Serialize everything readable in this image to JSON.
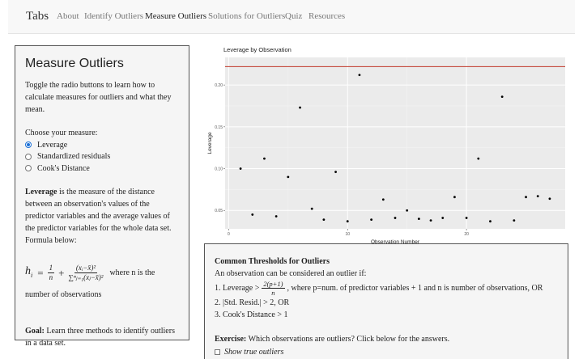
{
  "navbar": {
    "brand": "Tabs",
    "items": [
      {
        "label": "About",
        "active": false
      },
      {
        "label": "Identify Outliers",
        "active": false
      },
      {
        "label": "Measure Outliers",
        "active": true
      },
      {
        "label": "Solutions for Outliers",
        "active": false
      },
      {
        "label": "Quiz",
        "active": false
      },
      {
        "label": "Resources",
        "active": false
      }
    ]
  },
  "sidebar": {
    "title": "Measure Outliers",
    "intro": "Toggle the radio buttons to learn how to calculate measures for outliers and what they mean.",
    "choose_label": "Choose your measure:",
    "options": [
      {
        "label": "Leverage",
        "checked": true
      },
      {
        "label": "Standardized residuals",
        "checked": false
      },
      {
        "label": "Cook's Distance",
        "checked": false
      }
    ],
    "desc_bold": "Leverage",
    "desc_rest": " is the measure of the distance between an observation's values of the predictor variables and the average values of the predictor variables for the whole data set. Formula below:",
    "formula": {
      "lhs": "h",
      "lhs_sub": "i",
      "equals": "=",
      "t1_num": "1",
      "t1_den": "n",
      "plus": "+",
      "t2_num": "(xᵢ−x̄)²",
      "t2_den": "∑ⁿⱼ₌₁(xⱼ−x̄)²",
      "where_text": "where n is the",
      "cont_text": "number of observations"
    },
    "goal_bold": "Goal:",
    "goal_rest": " Learn three methods to identify outliers in a data set."
  },
  "thresholds": {
    "title": "Common Thresholds for Outliers",
    "intro": "An observation can be considered an outlier if:",
    "item1_prefix": "1. Leverage >",
    "item1_num": "2(p+1)",
    "item1_den": "n",
    "item1_suffix": ", where p=num. of predictor variables + 1 and n is number of observations, OR",
    "item2": "2. |Std. Resid.| > 2, OR",
    "item3": "3. Cook's Distance > 1",
    "exercise_bold": "Exercise:",
    "exercise_rest": " Which observations are outliers? Click below for the answers.",
    "checkbox_label": "Show true outliers"
  },
  "chart_data": {
    "type": "scatter",
    "title": "Leverage by Observation",
    "xlabel": "Observation Number",
    "ylabel": "Leverage",
    "xlim": [
      -0.3,
      28.3
    ],
    "ylim": [
      0.028,
      0.233
    ],
    "xticks": [
      0,
      10,
      20
    ],
    "yticks": [
      0.05,
      0.1,
      0.15,
      0.2
    ],
    "ytick_labels": [
      "0.05",
      "0.10",
      "0.15",
      "0.20"
    ],
    "threshold": 0.222,
    "threshold_color": "#c0392b",
    "panel_color": "#ebebeb",
    "grid": true,
    "x": [
      1,
      2,
      3,
      4,
      5,
      6,
      7,
      8,
      9,
      10,
      11,
      12,
      13,
      14,
      15,
      16,
      17,
      18,
      19,
      20,
      21,
      22,
      23,
      24,
      25,
      26,
      27
    ],
    "y": [
      0.1,
      0.045,
      0.112,
      0.043,
      0.09,
      0.173,
      0.052,
      0.039,
      0.096,
      0.037,
      0.212,
      0.039,
      0.063,
      0.041,
      0.05,
      0.04,
      0.038,
      0.041,
      0.066,
      0.041,
      0.112,
      0.037,
      0.186,
      0.038,
      0.066,
      0.067,
      0.064
    ]
  }
}
